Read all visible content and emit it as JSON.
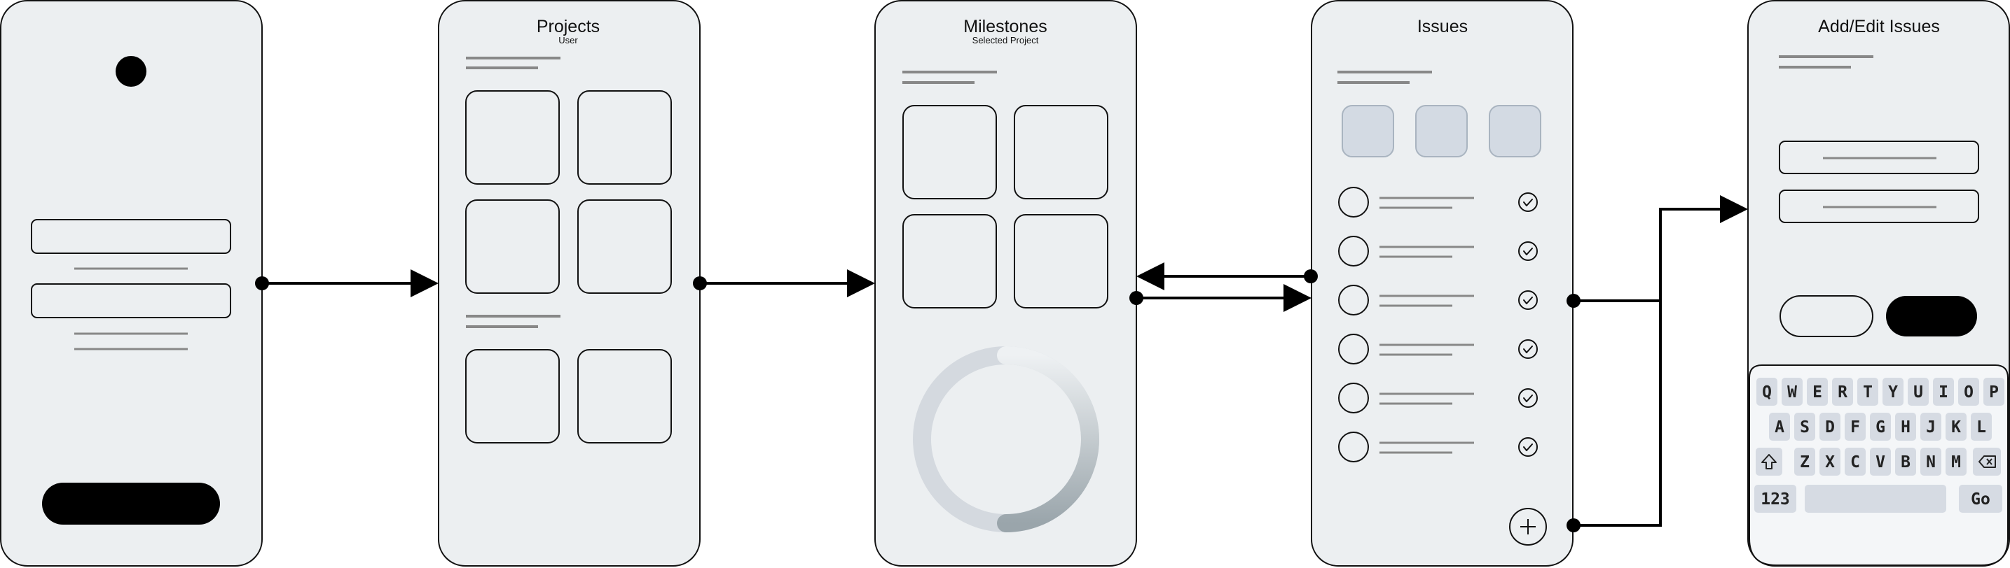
{
  "screens": {
    "login": {},
    "projects": {
      "title": "Projects",
      "subtitle": "User"
    },
    "milestones": {
      "title": "Milestones",
      "subtitle": "Selected Project"
    },
    "issues": {
      "title": "Issues"
    },
    "add_edit": {
      "title": "Add/Edit Issues"
    }
  },
  "keyboard": {
    "row1": [
      "Q",
      "W",
      "E",
      "R",
      "T",
      "Y",
      "U",
      "I",
      "O",
      "P"
    ],
    "row2": [
      "A",
      "S",
      "D",
      "F",
      "G",
      "H",
      "J",
      "K",
      "L"
    ],
    "row3": [
      "Z",
      "X",
      "C",
      "V",
      "B",
      "N",
      "M"
    ],
    "numbers_key": "123",
    "go_key": "Go"
  },
  "colors": {
    "phone_fill": "#eceff1",
    "outline": "#111111",
    "line": "#888888",
    "chip": "#d3dae3",
    "key": "#d6dbe3",
    "ring_light": "#d4d9df",
    "ring_dark": "#9ea8ae"
  },
  "icons": {
    "add": "plus-icon",
    "done": "check-circle-icon",
    "shift": "shift-icon",
    "backspace": "backspace-icon"
  }
}
